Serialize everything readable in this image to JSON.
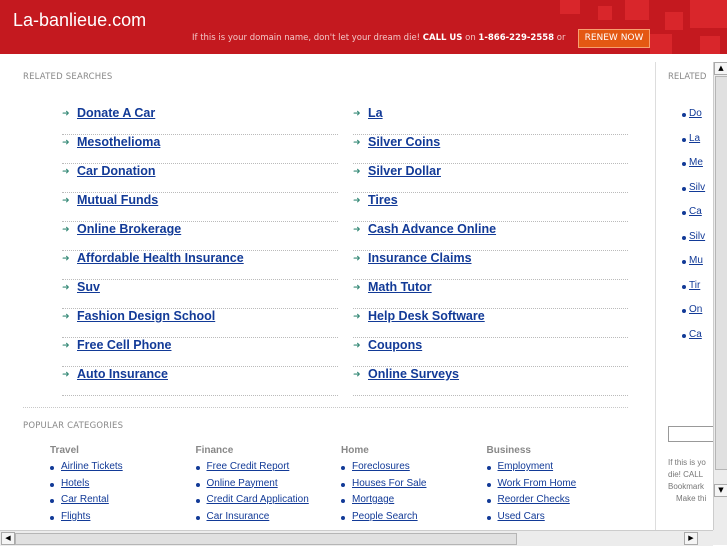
{
  "header": {
    "site_title": "La-banlieue.com",
    "promo_text": "If this is your domain name, don't let your dream die!",
    "promo_call": "CALL US",
    "promo_on": "on",
    "promo_phone": "1-866-229-2558",
    "promo_or": "or",
    "renew_label": "RENEW NOW"
  },
  "related_searches": {
    "title": "RELATED SEARCHES",
    "left": [
      "Donate A Car",
      "Mesothelioma",
      "Car Donation",
      "Mutual Funds",
      "Online Brokerage",
      "Affordable Health Insurance",
      "Suv",
      "Fashion Design School",
      "Free Cell Phone",
      "Auto Insurance"
    ],
    "right": [
      "La",
      "Silver Coins",
      "Silver Dollar",
      "Tires",
      "Cash Advance Online",
      "Insurance Claims",
      "Math Tutor",
      "Help Desk Software",
      "Coupons",
      "Online Surveys"
    ]
  },
  "popular": {
    "title": "POPULAR CATEGORIES",
    "categories": [
      {
        "name": "Travel",
        "items": [
          "Airline Tickets",
          "Hotels",
          "Car Rental",
          "Flights"
        ]
      },
      {
        "name": "Finance",
        "items": [
          "Free Credit Report",
          "Online Payment",
          "Credit Card Application",
          "Car Insurance"
        ]
      },
      {
        "name": "Home",
        "items": [
          "Foreclosures",
          "Houses For Sale",
          "Mortgage",
          "People Search"
        ]
      },
      {
        "name": "Business",
        "items": [
          "Employment",
          "Work From Home",
          "Reorder Checks",
          "Used Cars"
        ]
      }
    ]
  },
  "side_frame": {
    "title": "RELATED",
    "items": [
      "Do",
      "La",
      "Me",
      "Silv",
      "Ca",
      "Silv",
      "Mu",
      "Tir",
      "On",
      "Ca"
    ],
    "text_lines": [
      "If this is yo",
      "die! CALL",
      "Bookmark",
      "Make thi"
    ]
  },
  "colors": {
    "header_bg": "#c4191f",
    "link": "#123a97",
    "renew_bg": "#e45812"
  },
  "icons": {
    "list_arrow": "arrow-right-icon",
    "scroll_up": "arrow-up-icon",
    "scroll_down": "arrow-down-icon",
    "scroll_left": "arrow-left-icon",
    "scroll_right": "arrow-right-icon"
  }
}
